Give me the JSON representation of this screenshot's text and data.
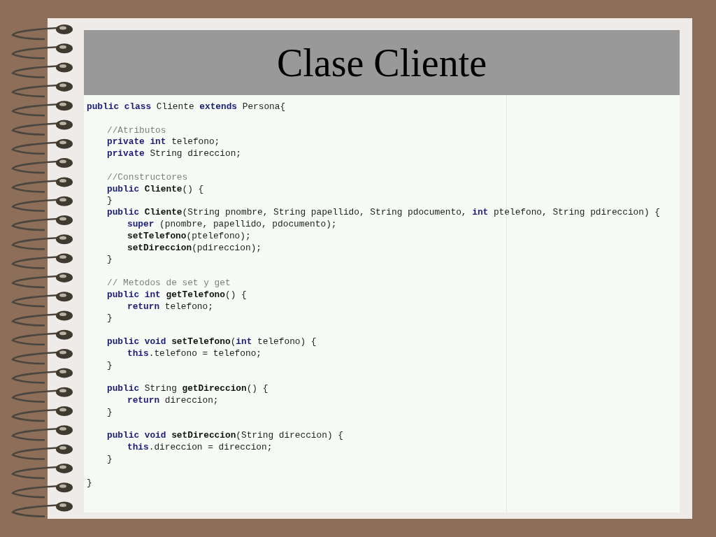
{
  "slide": {
    "title": "Clase Cliente"
  },
  "code": {
    "sections": [
      [
        {
          "tokens": [
            {
              "kind": "keyword",
              "text": "public class"
            },
            {
              "kind": "plain",
              "text": " Cliente "
            },
            {
              "kind": "keyword",
              "text": "extends"
            },
            {
              "kind": "plain",
              "text": " Persona{"
            }
          ],
          "sections": [
            [
              {
                "tokens": [
                  {
                    "kind": "comment",
                    "text": "//Atributos"
                  }
                ]
              },
              {
                "tokens": [
                  {
                    "kind": "keyword",
                    "text": "private int"
                  },
                  {
                    "kind": "plain",
                    "text": " telefono;"
                  }
                ]
              },
              {
                "tokens": [
                  {
                    "kind": "keyword",
                    "text": "private"
                  },
                  {
                    "kind": "plain",
                    "text": " String direccion;"
                  }
                ]
              }
            ],
            [
              {
                "tokens": [
                  {
                    "kind": "comment",
                    "text": "//Constructores"
                  }
                ]
              },
              {
                "tokens": [
                  {
                    "kind": "keyword",
                    "text": "public"
                  },
                  {
                    "kind": "method",
                    "text": " Cliente"
                  },
                  {
                    "kind": "plain",
                    "text": "() {"
                  }
                ]
              },
              {
                "tokens": [
                  {
                    "kind": "plain",
                    "text": "}"
                  }
                ]
              },
              {
                "tokens": [
                  {
                    "kind": "keyword",
                    "text": "public"
                  },
                  {
                    "kind": "method",
                    "text": " Cliente"
                  },
                  {
                    "kind": "plain",
                    "text": "(String pnombre, String papellido, String pdocumento, "
                  },
                  {
                    "kind": "keyword",
                    "text": "int"
                  },
                  {
                    "kind": "plain",
                    "text": " ptelefono, String pdireccion) {"
                  }
                ],
                "sections": [
                  [
                    {
                      "tokens": [
                        {
                          "kind": "keyword",
                          "text": "super"
                        },
                        {
                          "kind": "plain",
                          "text": " (pnombre, papellido, pdocumento);"
                        }
                      ]
                    },
                    {
                      "tokens": [
                        {
                          "kind": "method",
                          "text": "setTelefono"
                        },
                        {
                          "kind": "plain",
                          "text": "(ptelefono);"
                        }
                      ]
                    },
                    {
                      "tokens": [
                        {
                          "kind": "method",
                          "text": "setDireccion"
                        },
                        {
                          "kind": "plain",
                          "text": "(pdireccion);"
                        }
                      ]
                    }
                  ]
                ]
              },
              {
                "tokens": [
                  {
                    "kind": "plain",
                    "text": "}"
                  }
                ]
              }
            ],
            [
              {
                "tokens": [
                  {
                    "kind": "comment",
                    "text": "// Metodos de set y get"
                  }
                ]
              },
              {
                "tokens": [
                  {
                    "kind": "keyword",
                    "text": "public int"
                  },
                  {
                    "kind": "method",
                    "text": " getTelefono"
                  },
                  {
                    "kind": "plain",
                    "text": "() {"
                  }
                ],
                "sections": [
                  [
                    {
                      "tokens": [
                        {
                          "kind": "keyword",
                          "text": "return"
                        },
                        {
                          "kind": "plain",
                          "text": " telefono;"
                        }
                      ]
                    }
                  ]
                ]
              },
              {
                "tokens": [
                  {
                    "kind": "plain",
                    "text": "}"
                  }
                ]
              }
            ],
            [
              {
                "tokens": [
                  {
                    "kind": "keyword",
                    "text": "public void"
                  },
                  {
                    "kind": "method",
                    "text": " setTelefono"
                  },
                  {
                    "kind": "plain",
                    "text": "("
                  },
                  {
                    "kind": "keyword",
                    "text": "int"
                  },
                  {
                    "kind": "plain",
                    "text": " telefono) {"
                  }
                ],
                "sections": [
                  [
                    {
                      "tokens": [
                        {
                          "kind": "keyword",
                          "text": "this"
                        },
                        {
                          "kind": "plain",
                          "text": ".telefono = telefono;"
                        }
                      ]
                    }
                  ]
                ]
              },
              {
                "tokens": [
                  {
                    "kind": "plain",
                    "text": "}"
                  }
                ]
              }
            ],
            [
              {
                "tokens": [
                  {
                    "kind": "keyword",
                    "text": "public"
                  },
                  {
                    "kind": "plain",
                    "text": " String "
                  },
                  {
                    "kind": "method",
                    "text": "getDireccion"
                  },
                  {
                    "kind": "plain",
                    "text": "() {"
                  }
                ],
                "sections": [
                  [
                    {
                      "tokens": [
                        {
                          "kind": "keyword",
                          "text": "return"
                        },
                        {
                          "kind": "plain",
                          "text": " direccion;"
                        }
                      ]
                    }
                  ]
                ]
              },
              {
                "tokens": [
                  {
                    "kind": "plain",
                    "text": "}"
                  }
                ]
              }
            ],
            [
              {
                "tokens": [
                  {
                    "kind": "keyword",
                    "text": "public void"
                  },
                  {
                    "kind": "method",
                    "text": " setDireccion"
                  },
                  {
                    "kind": "plain",
                    "text": "(String direccion) {"
                  }
                ],
                "sections": [
                  [
                    {
                      "tokens": [
                        {
                          "kind": "keyword",
                          "text": "this"
                        },
                        {
                          "kind": "plain",
                          "text": ".direccion = direccion;"
                        }
                      ]
                    }
                  ]
                ]
              },
              {
                "tokens": [
                  {
                    "kind": "plain",
                    "text": "}"
                  }
                ]
              }
            ]
          ]
        }
      ],
      [
        {
          "tokens": [
            {
              "kind": "plain",
              "text": "}"
            }
          ]
        }
      ]
    ]
  }
}
